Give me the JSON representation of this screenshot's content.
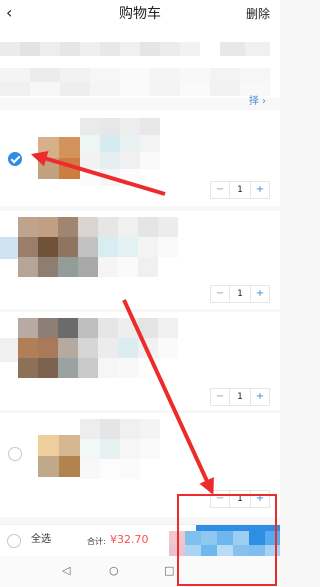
{
  "header": {
    "back_icon": "chevron-left-icon",
    "back_glyph": "‹",
    "title": "购物车",
    "edit_label": "删除"
  },
  "store": {
    "link_label": "择 ›"
  },
  "items": [
    {
      "checked": true,
      "quantity": "1"
    },
    {
      "checked": false,
      "quantity": "1"
    },
    {
      "checked": false,
      "quantity": "1"
    },
    {
      "checked": false,
      "quantity": "1"
    }
  ],
  "stepper": {
    "minus": "−",
    "plus": "+"
  },
  "bottom": {
    "select_all_label": "全选",
    "total_label": "合计:",
    "total_value": "¥32.70"
  },
  "nav": {
    "back": "◁",
    "home": "○",
    "recents": "□"
  },
  "colors": {
    "accent": "#2f8de4",
    "price": "#ff4f4f",
    "annotation": "#ee2b2b"
  }
}
